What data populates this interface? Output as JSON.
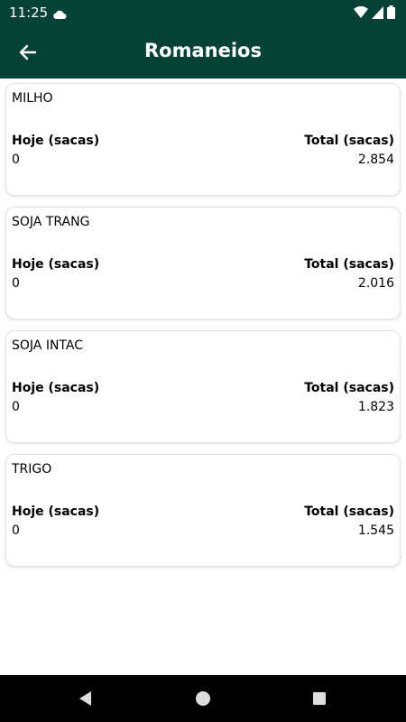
{
  "status_bar": {
    "time": "11:25",
    "icons": [
      "cloud-icon",
      "wifi-icon",
      "signal-icon",
      "battery-icon"
    ]
  },
  "app_bar": {
    "title": "Romaneios",
    "back_icon": "arrow-left-icon",
    "background": "#064237"
  },
  "cards": [
    {
      "name": "MILHO",
      "today_label": "Hoje (sacas)",
      "today_value": "0",
      "total_label": "Total (sacas)",
      "total_value": "2.854"
    },
    {
      "name": "SOJA TRANG",
      "today_label": "Hoje (sacas)",
      "today_value": "0",
      "total_label": "Total (sacas)",
      "total_value": "2.016"
    },
    {
      "name": "SOJA INTAC",
      "today_label": "Hoje (sacas)",
      "today_value": "0",
      "total_label": "Total (sacas)",
      "total_value": "1.823"
    },
    {
      "name": "TRIGO",
      "today_label": "Hoje (sacas)",
      "today_value": "0",
      "total_label": "Total (sacas)",
      "total_value": "1.545"
    }
  ],
  "nav_bar": {
    "icons": [
      "back-triangle-icon",
      "home-circle-icon",
      "recents-square-icon"
    ]
  }
}
